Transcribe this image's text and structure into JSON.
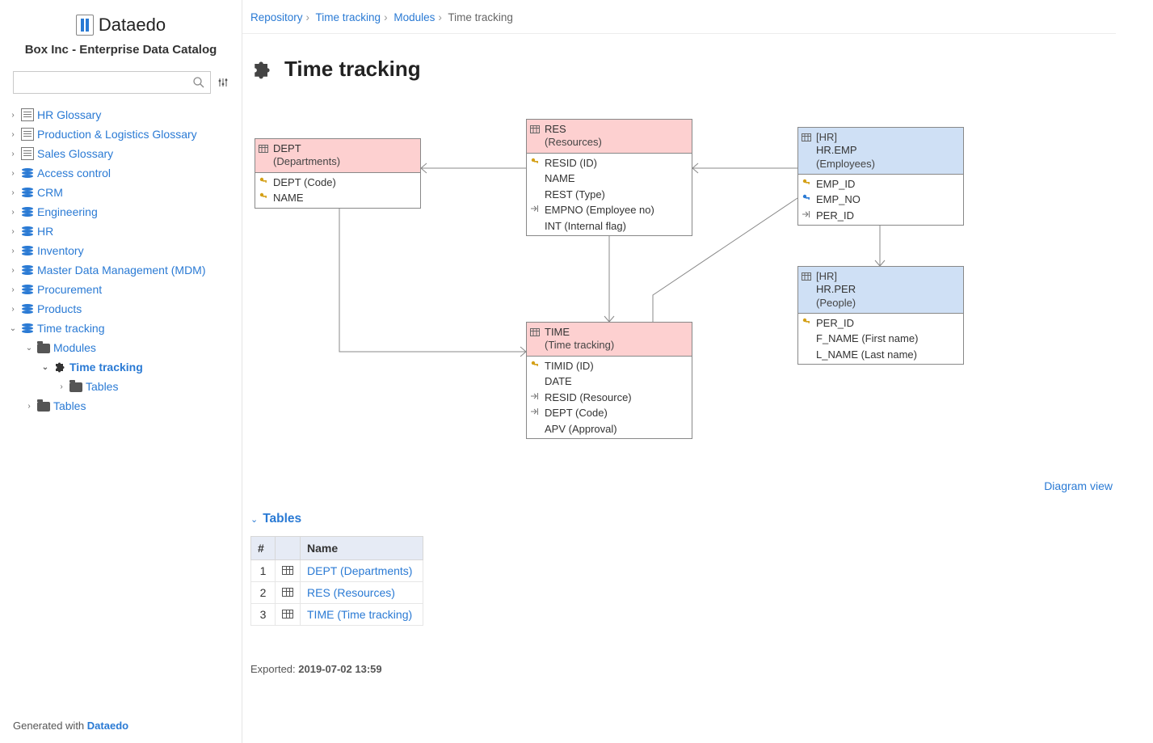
{
  "app": {
    "brand": "Dataedo",
    "subtitle": "Box Inc - Enterprise Data Catalog"
  },
  "search": {
    "placeholder": ""
  },
  "sidebar": {
    "items": [
      {
        "label": "HR Glossary",
        "icon": "book"
      },
      {
        "label": "Production & Logistics Glossary",
        "icon": "book"
      },
      {
        "label": "Sales Glossary",
        "icon": "book"
      },
      {
        "label": "Access control",
        "icon": "stack"
      },
      {
        "label": "CRM",
        "icon": "stack"
      },
      {
        "label": "Engineering",
        "icon": "stack"
      },
      {
        "label": "HR",
        "icon": "stack"
      },
      {
        "label": "Inventory",
        "icon": "stack"
      },
      {
        "label": "Master Data Management (MDM)",
        "icon": "stack"
      },
      {
        "label": "Procurement",
        "icon": "stack"
      },
      {
        "label": "Products",
        "icon": "stack"
      }
    ],
    "time_tracking": {
      "label": "Time tracking"
    },
    "modules": {
      "label": "Modules"
    },
    "module_active": {
      "label": "Time tracking"
    },
    "tables_inner": {
      "label": "Tables"
    },
    "tables_outer": {
      "label": "Tables"
    }
  },
  "footer": {
    "prefix": "Generated with ",
    "brand": "Dataedo"
  },
  "breadcrumb": {
    "a": "Repository",
    "b": "Time tracking",
    "c": "Modules",
    "d": "Time tracking"
  },
  "page": {
    "title": "Time tracking"
  },
  "erd": {
    "dept": {
      "name": "DEPT",
      "sub": "(Departments)",
      "cols": [
        "DEPT (Code)",
        "NAME"
      ]
    },
    "res": {
      "name": "RES",
      "sub": "(Resources)",
      "cols": [
        "RESID (ID)",
        "NAME",
        "REST (Type)",
        "EMPNO (Employee no)",
        "INT (Internal flag)"
      ]
    },
    "time": {
      "name": "TIME",
      "sub": "(Time tracking)",
      "cols": [
        "TIMID (ID)",
        "DATE",
        "RESID (Resource)",
        "DEPT (Code)",
        "APV (Approval)"
      ]
    },
    "emp": {
      "schema": "[HR]",
      "name": "HR.EMP",
      "sub": "(Employees)",
      "cols": [
        "EMP_ID",
        "EMP_NO",
        "PER_ID"
      ]
    },
    "per": {
      "schema": "[HR]",
      "name": "HR.PER",
      "sub": "(People)",
      "cols": [
        "PER_ID",
        "F_NAME (First name)",
        "L_NAME (Last name)"
      ]
    }
  },
  "diagram_link": "Diagram view",
  "tables_section": {
    "heading": "Tables",
    "cols": {
      "num": "#",
      "icon": "",
      "name": "Name"
    },
    "rows": [
      {
        "n": "1",
        "name": "DEPT (Departments)"
      },
      {
        "n": "2",
        "name": "RES (Resources)"
      },
      {
        "n": "3",
        "name": "TIME (Time tracking)"
      }
    ]
  },
  "exported": {
    "label": "Exported: ",
    "ts": "2019-07-02 13:59"
  }
}
